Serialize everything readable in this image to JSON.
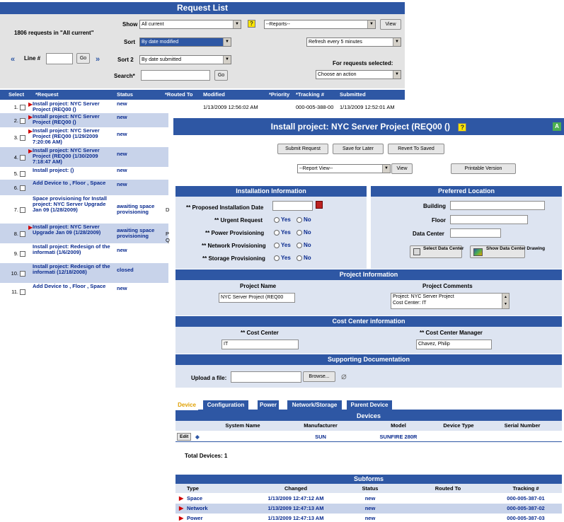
{
  "list": {
    "title": "Request List",
    "count_text": "1806 requests in \"All current\"",
    "show_label": "Show",
    "show_value": "All current",
    "help_icon": "?",
    "reports_value": "--Reports--",
    "view_label": "View",
    "sort_label": "Sort",
    "sort_value": "By date modified",
    "refresh_value": "Refresh every 5 minutes",
    "line_label": "Line #",
    "go_label": "Go",
    "sort2_label": "Sort 2",
    "sort2_value": "By date submitted",
    "for_selected": "For requests selected:",
    "search_label": "Search*",
    "action_value": "Choose an action",
    "columns": [
      "Select",
      "*Request",
      "Status",
      "*Routed To",
      "Modified",
      "*Priority",
      "*Tracking #",
      "Submitted"
    ],
    "rows": [
      {
        "n": "1.",
        "request": "Install project: NYC Server Project (REQ00 ()",
        "status": "new",
        "flag": true,
        "modified": "1/13/2009 12:56:02 AM",
        "tracking": "000-005-388-00",
        "submitted": "1/13/2009 12:52:01 AM"
      },
      {
        "n": "2.",
        "request": "Install project: NYC Server Project (REQ00 ()",
        "status": "new",
        "flag": true
      },
      {
        "n": "3.",
        "request": "Install project: NYC Server Project (REQ00 (1/29/2009 7:20:06 AM)",
        "status": "new",
        "flag": true
      },
      {
        "n": "4.",
        "request": "Install project: NYC Server Project (REQ00 (1/30/2009 7:18:47 AM)",
        "status": "new",
        "flag": true
      },
      {
        "n": "5.",
        "request": "Install project: ()",
        "status": "new",
        "flag": false
      },
      {
        "n": "6.",
        "request": "Add Device to , Floor , Space",
        "status": "new",
        "flag": false
      },
      {
        "n": "7.",
        "request": "Space provisioning for Install project: NYC Server Upgrade Jan 09 (1/28/2009)",
        "status": "awaiting space provisioning",
        "flag": false,
        "routed": "D"
      },
      {
        "n": "8.",
        "request": "Install project: NYC Server Upgrade Jan 09 (1/28/2009)",
        "status": "awaiting space provisioning",
        "flag": true,
        "routed": "P Q"
      },
      {
        "n": "9.",
        "request": "Install project: Redesign of the informati (1/6/2009)",
        "status": "new",
        "flag": false
      },
      {
        "n": "10.",
        "request": "Install project: Redesign of the informati (12/18/2008)",
        "status": "closed",
        "flag": false
      },
      {
        "n": "11.",
        "request": "Add Device to , Floor , Space",
        "status": "new",
        "flag": false
      }
    ]
  },
  "detail": {
    "title": "Install project: NYC Server Project (REQ00 ()",
    "corner_a": "A",
    "submit": "Submit Request",
    "save_later": "Save for Later",
    "revert": "Revert To Saved",
    "report_view": "--Report View--",
    "view": "View",
    "printable": "Printable Version",
    "install_info": {
      "title": "Installation Information",
      "date_label": "** Proposed Installation Date",
      "urgent_label": "** Urgent Request",
      "power_label": "** Power Provisioning",
      "network_label": "** Network Provisioning",
      "storage_label": "** Storage Provisioning",
      "yes": "Yes",
      "no": "No"
    },
    "location": {
      "title": "Preferred Location",
      "building": "Building",
      "floor": "Floor",
      "datacenter": "Data Center",
      "select_dc": "Select Data Center",
      "show_drawing": "Show Data Center Drawing"
    },
    "project": {
      "title": "Project Information",
      "name_label": "Project Name",
      "name_value": "NYC Server Project (REQ00",
      "comments_label": "Project Comments",
      "comments_line1": "Project: NYC Server Project",
      "comments_line2": "Cost Center: IT"
    },
    "cost": {
      "title": "Cost Center information",
      "center_label": "** Cost Center",
      "center_value": "IT",
      "manager_label": "** Cost Center Manager",
      "manager_value": "Chavez, Philip"
    },
    "docs": {
      "title": "Supporting Documentation",
      "upload_label": "Upload a file:",
      "browse": "Browse..."
    },
    "tabs": [
      "Device",
      "Configuration",
      "Power",
      "Network/Storage",
      "Parent Device"
    ],
    "devices": {
      "title": "Devices",
      "columns": [
        "System Name",
        "Manufacturer",
        "Model",
        "Device Type",
        "Serial Number"
      ],
      "edit": "Edit",
      "manufacturer": "SUN",
      "model": "SUNFIRE 280R",
      "total": "Total Devices:  1"
    },
    "subforms": {
      "title": "Subforms",
      "columns": [
        "Type",
        "Changed",
        "Status",
        "Routed To",
        "Tracking #"
      ],
      "rows": [
        {
          "type": "Space",
          "changed": "1/13/2009 12:47:12 AM",
          "status": "new",
          "tracking": "000-005-387-01"
        },
        {
          "type": "Network",
          "changed": "1/13/2009 12:47:13 AM",
          "status": "new",
          "tracking": "000-005-387-02"
        },
        {
          "type": "Power",
          "changed": "1/13/2009 12:47:13 AM",
          "status": "new",
          "tracking": "000-005-387-03"
        }
      ]
    }
  }
}
